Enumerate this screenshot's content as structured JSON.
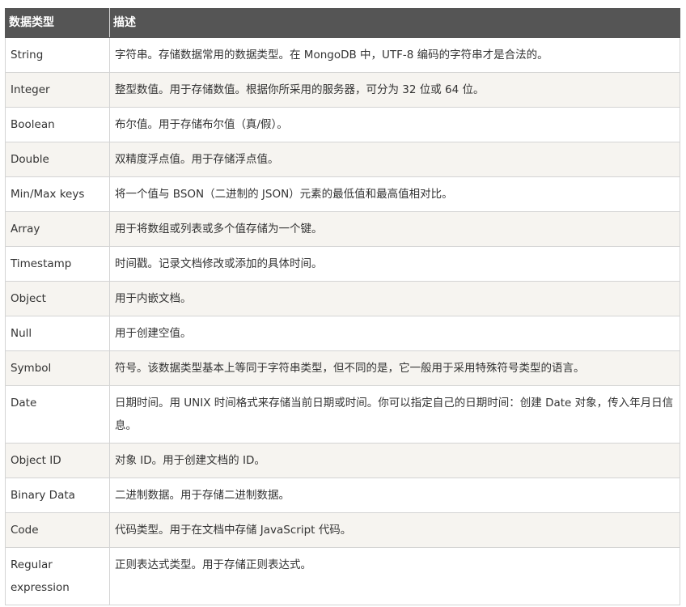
{
  "table": {
    "headers": [
      "数据类型",
      "描述"
    ],
    "rows": [
      {
        "type": "String",
        "desc": "字符串。存储数据常用的数据类型。在 MongoDB 中，UTF-8 编码的字符串才是合法的。"
      },
      {
        "type": "Integer",
        "desc": "整型数值。用于存储数值。根据你所采用的服务器，可分为 32 位或 64 位。"
      },
      {
        "type": "Boolean",
        "desc": "布尔值。用于存储布尔值（真/假）。"
      },
      {
        "type": "Double",
        "desc": "双精度浮点值。用于存储浮点值。"
      },
      {
        "type": "Min/Max keys",
        "desc": "将一个值与 BSON（二进制的 JSON）元素的最低值和最高值相对比。"
      },
      {
        "type": "Array",
        "desc": "用于将数组或列表或多个值存储为一个键。"
      },
      {
        "type": "Timestamp",
        "desc": "时间戳。记录文档修改或添加的具体时间。"
      },
      {
        "type": "Object",
        "desc": "用于内嵌文档。"
      },
      {
        "type": "Null",
        "desc": "用于创建空值。"
      },
      {
        "type": "Symbol",
        "desc": "符号。该数据类型基本上等同于字符串类型，但不同的是，它一般用于采用特殊符号类型的语言。"
      },
      {
        "type": "Date",
        "desc": "日期时间。用 UNIX 时间格式来存储当前日期或时间。你可以指定自己的日期时间：创建 Date 对象，传入年月日信息。"
      },
      {
        "type": "Object ID",
        "desc": "对象 ID。用于创建文档的 ID。"
      },
      {
        "type": "Binary Data",
        "desc": "二进制数据。用于存储二进制数据。"
      },
      {
        "type": "Code",
        "desc": "代码类型。用于在文档中存储 JavaScript 代码。"
      },
      {
        "type": "Regular expression",
        "desc": "正则表达式类型。用于存储正则表达式。"
      }
    ]
  }
}
